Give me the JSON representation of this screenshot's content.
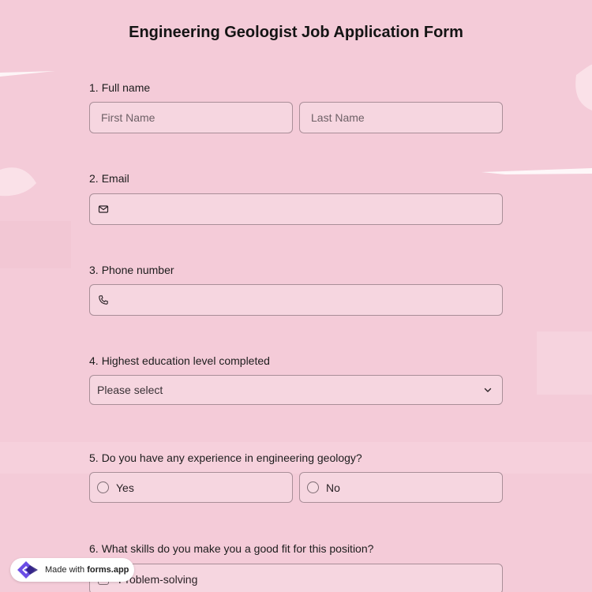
{
  "form": {
    "title": "Engineering Geologist Job Application Form"
  },
  "questions": [
    {
      "number": "1.",
      "label": "Full name",
      "first_placeholder": "First Name",
      "last_placeholder": "Last Name"
    },
    {
      "number": "2.",
      "label": "Email",
      "icon": "envelope-icon"
    },
    {
      "number": "3.",
      "label": "Phone number",
      "icon": "phone-icon"
    },
    {
      "number": "4.",
      "label": "Highest education level completed",
      "select_value": "Please select",
      "icon": "chevron-down-icon"
    },
    {
      "number": "5.",
      "label": "Do you have any experience in engineering geology?",
      "options": [
        "Yes",
        "No"
      ]
    },
    {
      "number": "6.",
      "label": "What skills do you make you a good fit for this position?",
      "options": [
        "Problem-solving"
      ]
    }
  ],
  "badge": {
    "prefix": "Made with",
    "brand": "forms.app",
    "icon": "forms-app-logo-icon"
  },
  "colors": {
    "background": "#f4cbd8",
    "border": "#a98e98",
    "badge_logo": "#6b4de6"
  }
}
